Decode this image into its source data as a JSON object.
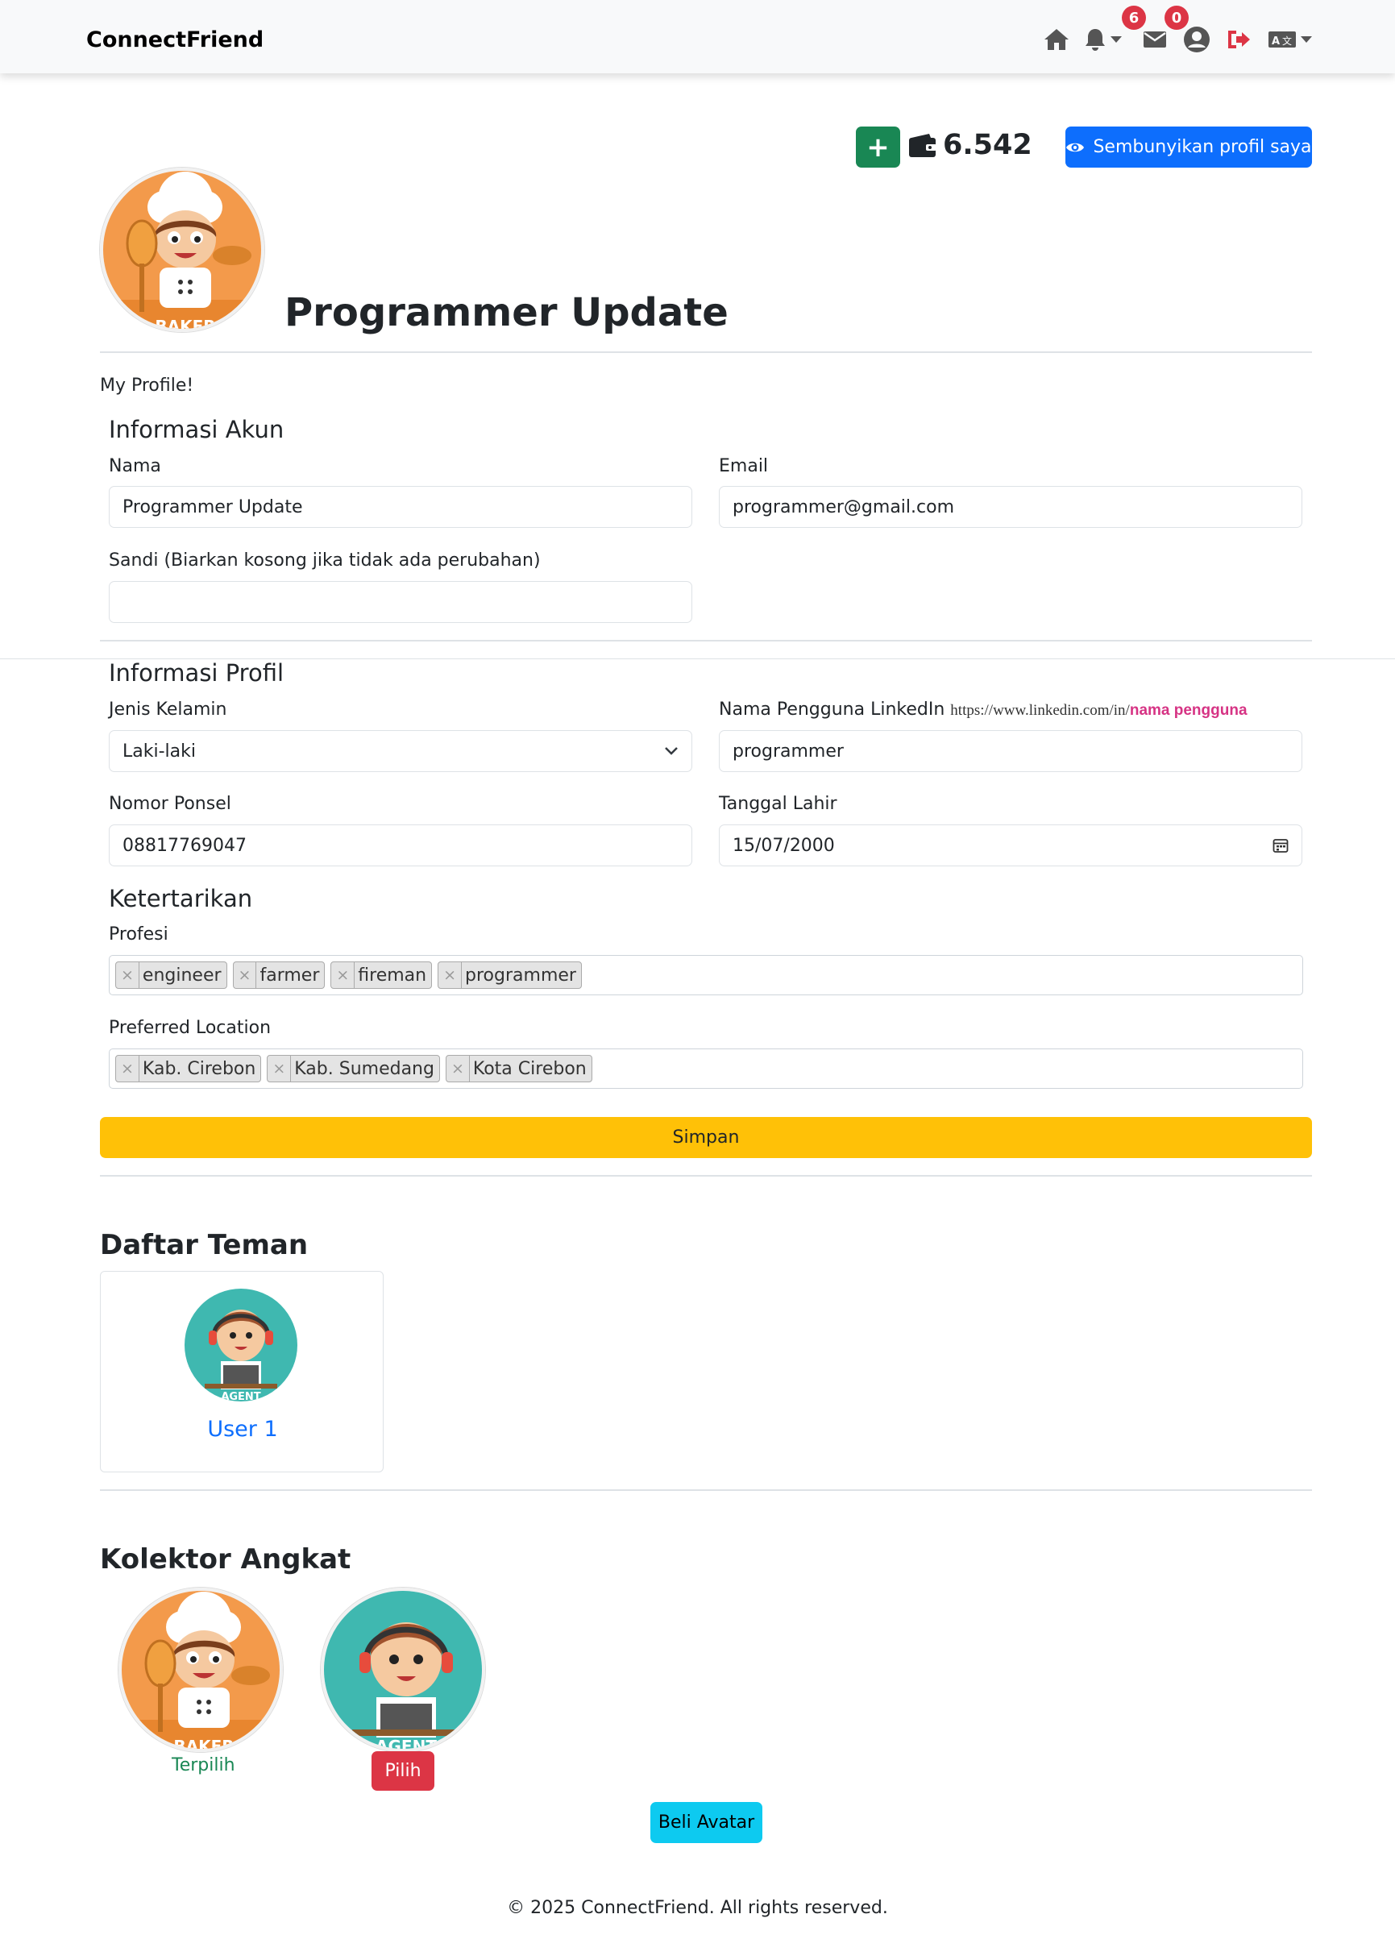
{
  "navbar": {
    "brand": "ConnectFriend",
    "notif_count": "6",
    "mail_count": "0",
    "icons": [
      "home-icon",
      "bell-icon",
      "envelope-icon",
      "user-circle-icon",
      "logout-icon",
      "language-icon"
    ]
  },
  "toolbar": {
    "plus_label": "+",
    "coins": "6.542",
    "hide_profile_label": "Sembunyikan profil saya"
  },
  "profile": {
    "name_title": "Programmer Update",
    "intro": "My Profile!"
  },
  "account": {
    "heading": "Informasi Akun",
    "name_label": "Nama",
    "name_value": "Programmer Update",
    "email_label": "Email",
    "email_value": "programmer@gmail.com",
    "password_label": "Sandi (Biarkan kosong jika tidak ada perubahan)",
    "password_value": ""
  },
  "profile_info": {
    "heading": "Informasi Profil",
    "gender_label": "Jenis Kelamin",
    "gender_value": "Laki-laki",
    "linkedin_label": "Nama Pengguna LinkedIn",
    "linkedin_hint_prefix": "https://www.linkedin.com/in/",
    "linkedin_hint_bold": "nama pengguna",
    "linkedin_value": "programmer",
    "phone_label": "Nomor Ponsel",
    "phone_value": "08817769047",
    "dob_label": "Tanggal Lahir",
    "dob_value": "15/07/2000"
  },
  "interests": {
    "heading": "Ketertarikan",
    "profession_label": "Profesi",
    "professions": [
      "engineer",
      "farmer",
      "fireman",
      "programmer"
    ],
    "location_label": "Preferred Location",
    "locations": [
      "Kab. Cirebon",
      "Kab. Sumedang",
      "Kota Cirebon"
    ]
  },
  "save_label": "Simpan",
  "friends": {
    "heading": "Daftar Teman",
    "items": [
      {
        "name": "User 1",
        "avatar_text": "AGENT"
      }
    ]
  },
  "collector": {
    "heading": "Kolektor Angkat",
    "items": [
      {
        "avatar_text": "BAKER",
        "status": "Terpilih"
      },
      {
        "avatar_text": "AGENT",
        "action": "Pilih"
      }
    ],
    "buy_label": "Beli Avatar"
  },
  "footer": "© 2025 ConnectFriend. All rights reserved.",
  "colors": {
    "success": "#198754",
    "primary": "#0d6efd",
    "warning": "#ffc107",
    "danger": "#dc3545",
    "info": "#0dcaf0",
    "link": "#0d6efd"
  }
}
